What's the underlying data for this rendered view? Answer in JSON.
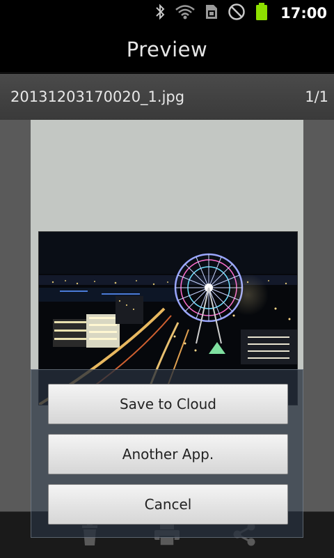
{
  "status_bar": {
    "time": "17:00",
    "icons": [
      "bluetooth-icon",
      "wifi-icon",
      "sim-card-icon",
      "no-sound-icon",
      "battery-icon"
    ],
    "battery_color": "#8ee000"
  },
  "header": {
    "title": "Preview"
  },
  "file_bar": {
    "filename": "20131203170020_1.jpg",
    "page_indicator": "1/1"
  },
  "dialog": {
    "save_to_cloud": "Save to Cloud",
    "another_app": "Another App.",
    "cancel": "Cancel"
  },
  "toolbar": {
    "icons": [
      "trash-icon",
      "printer-icon",
      "share-icon"
    ]
  },
  "colors": {
    "background": "#000000",
    "file_bar": "#404040",
    "paper": "#c3c7c3",
    "preview_bg": "#5a5a5a",
    "dialog_overlay": "#26303c"
  }
}
